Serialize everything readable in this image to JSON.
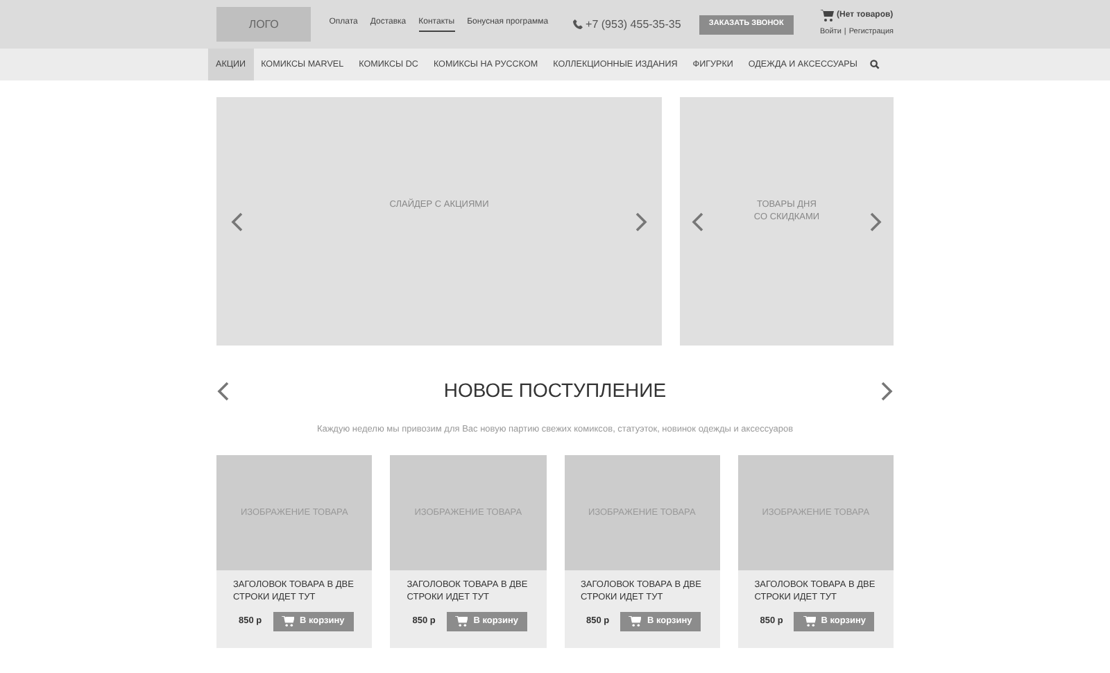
{
  "header": {
    "logo": "ЛОГО",
    "links": [
      {
        "label": "Оплата",
        "selected": false
      },
      {
        "label": "Доставка",
        "selected": false
      },
      {
        "label": "Контакты",
        "selected": true
      },
      {
        "label": "Бонусная программа",
        "selected": false
      }
    ],
    "phone": "+7 (953) 455-35-35",
    "callback_button": "ЗАКАЗАТЬ ЗВОНОК",
    "cart": "(Нет товаров)",
    "login": "Войти",
    "separator": "|",
    "register": "Регистрация"
  },
  "nav": [
    {
      "label": "АКЦИИ",
      "selected": true
    },
    {
      "label": "КОМИКСЫ MARVEL",
      "selected": false
    },
    {
      "label": "КОМИКСЫ DC",
      "selected": false
    },
    {
      "label": "КОМИКСЫ НА РУССКОМ",
      "selected": false
    },
    {
      "label": "КОЛЛЕКЦИОННЫЕ ИЗДАНИЯ",
      "selected": false
    },
    {
      "label": "ФИГУРКИ",
      "selected": false
    },
    {
      "label": "ОДЕЖДА И АКСЕССУАРЫ",
      "selected": false
    }
  ],
  "slider": {
    "label": "СЛАЙДЕР С АКЦИЯМИ"
  },
  "deals": {
    "lines": [
      "ТОВАРЫ ДНЯ",
      "СО СКИДКАМИ"
    ]
  },
  "new_arrivals": {
    "title": "НОВОЕ ПОСТУПЛЕНИЕ",
    "subtitle": "Каждую неделю мы привозим для Вас новую партию свежих комиксов, статуэток, новинок одежды и аксессуаров"
  },
  "products": [
    {
      "image_label": "ИЗОБРАЖЕНИЕ ТОВАРА",
      "title_lines": [
        "ЗАГОЛОВОК ТОВАРА В ДВЕ",
        "СТРОКИ ИДЕТ ТУТ"
      ],
      "price": "850 р",
      "button": "В корзину"
    },
    {
      "image_label": "ИЗОБРАЖЕНИЕ ТОВАРА",
      "title_lines": [
        "ЗАГОЛОВОК ТОВАРА В ДВЕ",
        "СТРОКИ ИДЕТ ТУТ"
      ],
      "price": "850 р",
      "button": "В корзину"
    },
    {
      "image_label": "ИЗОБРАЖЕНИЕ ТОВАРА",
      "title_lines": [
        "ЗАГОЛОВОК ТОВАРА В ДВЕ",
        "СТРОКИ ИДЕТ ТУТ"
      ],
      "price": "850 р",
      "button": "В корзину"
    },
    {
      "image_label": "ИЗОБРАЖЕНИЕ ТОВАРА",
      "title_lines": [
        "ЗАГОЛОВОК ТОВАРА В ДВЕ",
        "СТРОКИ ИДЕТ ТУТ"
      ],
      "price": "850 р",
      "button": "В корзину"
    }
  ]
}
